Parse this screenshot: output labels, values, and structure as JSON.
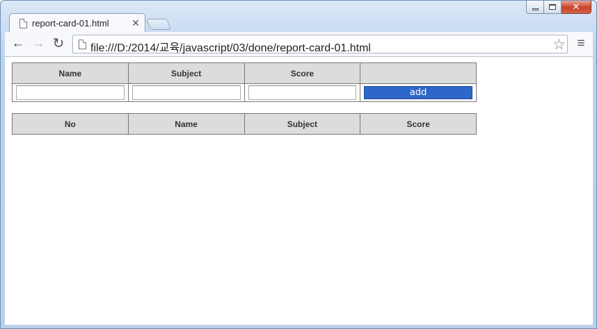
{
  "browser": {
    "tab_title": "report-card-01.html",
    "url": "file:///D:/2014/교육/javascript/03/done/report-card-01.html",
    "icons": {
      "back": "back-arrow-icon",
      "forward": "forward-arrow-icon",
      "reload": "reload-icon",
      "bookmark": "star-icon",
      "menu": "hamburger-menu-icon"
    }
  },
  "form_table": {
    "headers": [
      "Name",
      "Subject",
      "Score",
      ""
    ],
    "inputs": {
      "name": {
        "value": "",
        "placeholder": ""
      },
      "subject": {
        "value": "",
        "placeholder": ""
      },
      "score": {
        "value": "",
        "placeholder": ""
      }
    },
    "add_label": "add"
  },
  "list_table": {
    "headers": [
      "No",
      "Name",
      "Subject",
      "Score"
    ],
    "rows": []
  },
  "colors": {
    "add_button": "#2e66c9",
    "header_bg": "#dcdcdc"
  }
}
